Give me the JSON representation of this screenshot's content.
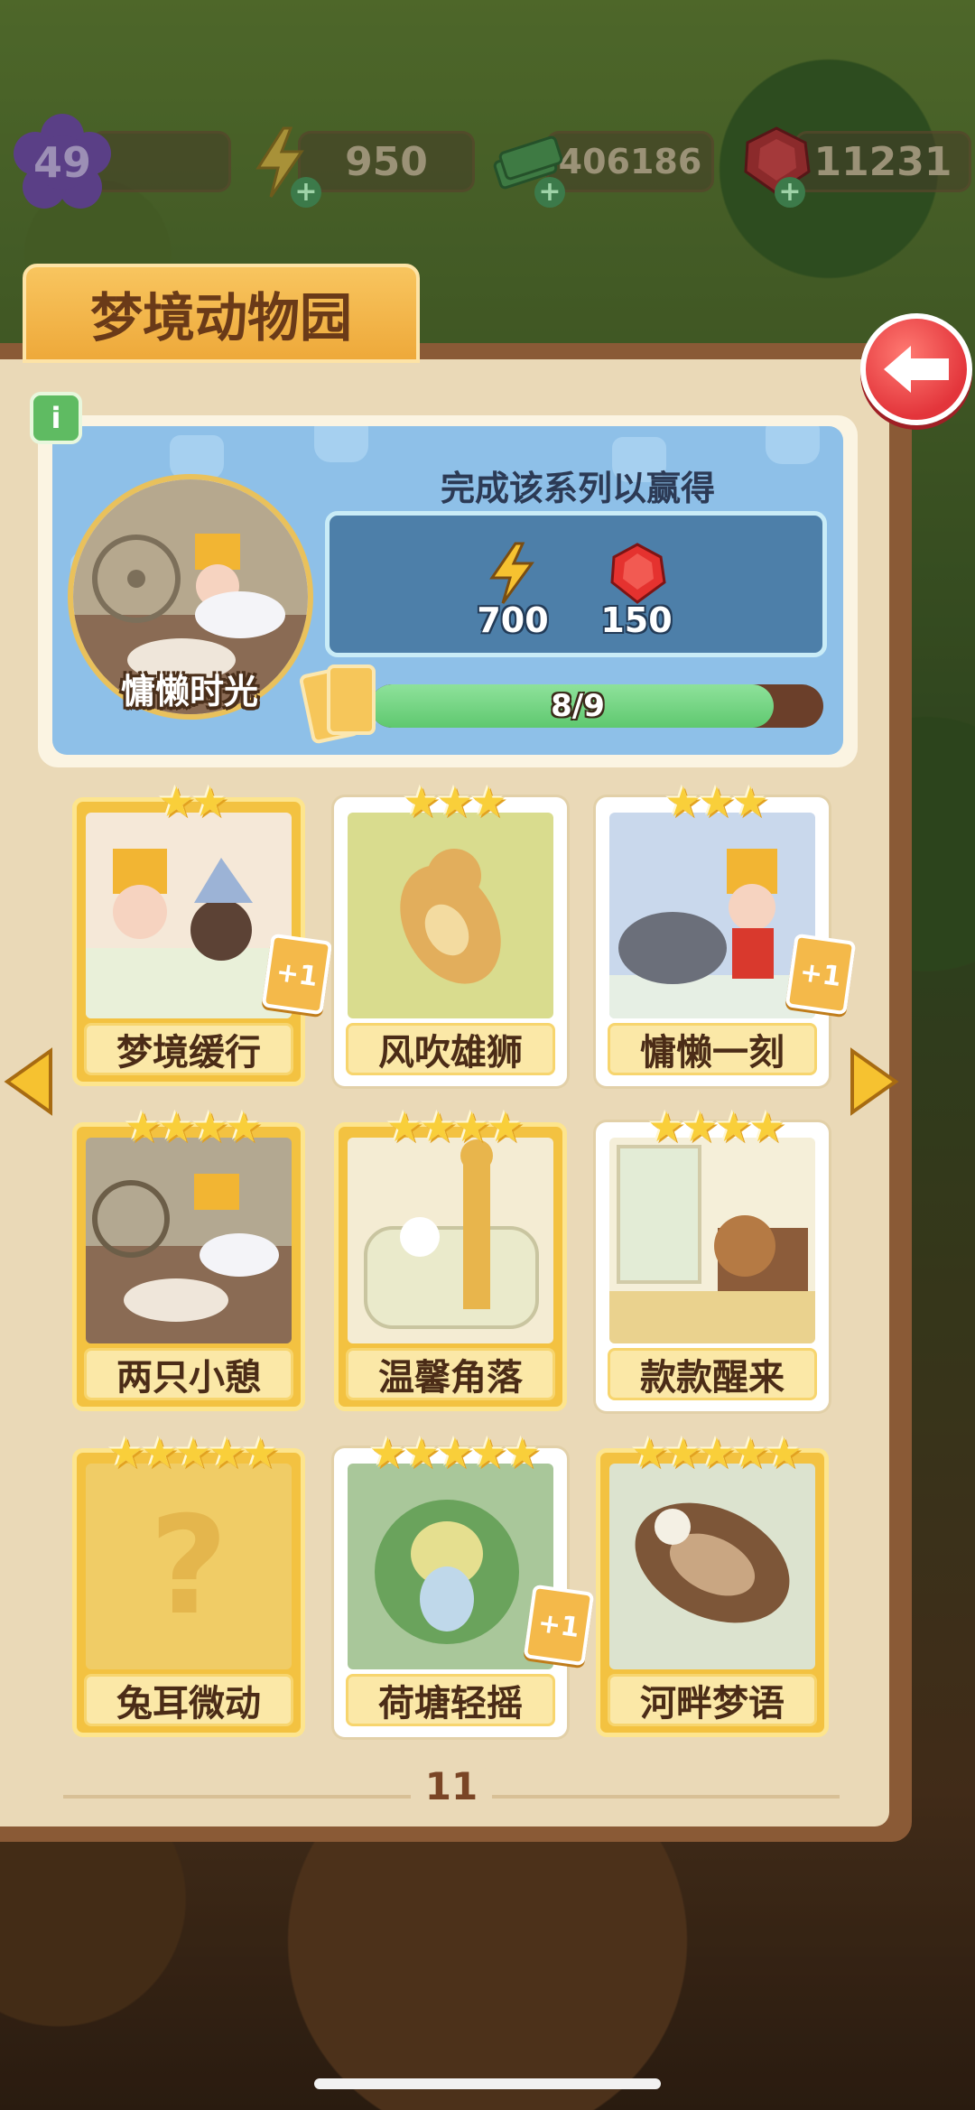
{
  "resources": {
    "level": "49",
    "energy": "950",
    "cash": "406186",
    "gems": "11231"
  },
  "panel": {
    "title": "梦境动物园",
    "info_label": "i"
  },
  "collection": {
    "name": "慵懒时光",
    "reward_title": "完成该系列以赢得",
    "rewards": [
      {
        "icon": "lightning-icon",
        "amount": "700"
      },
      {
        "icon": "ruby-icon",
        "amount": "150"
      }
    ],
    "progress_text": "8/9",
    "progress_fraction": 0.89
  },
  "cards": [
    {
      "label": "梦境缓行",
      "stars": 2,
      "style": "gold",
      "plus": "+1"
    },
    {
      "label": "风吹雄狮",
      "stars": 3,
      "style": "white",
      "plus": ""
    },
    {
      "label": "慵懒一刻",
      "stars": 3,
      "style": "white",
      "plus": "+1"
    },
    {
      "label": "两只小憩",
      "stars": 4,
      "style": "gold",
      "plus": ""
    },
    {
      "label": "温馨角落",
      "stars": 4,
      "style": "gold",
      "plus": ""
    },
    {
      "label": "款款醒来",
      "stars": 4,
      "style": "white",
      "plus": ""
    },
    {
      "label": "兔耳微动",
      "stars": 5,
      "style": "gold",
      "plus": "",
      "locked_glyph": "?"
    },
    {
      "label": "荷塘轻摇",
      "stars": 5,
      "style": "white",
      "plus": "+1"
    },
    {
      "label": "河畔梦语",
      "stars": 5,
      "style": "gold",
      "plus": ""
    }
  ],
  "pagination": {
    "page": "11"
  },
  "colors": {
    "accent_gold": "#f3c241",
    "progress_green": "#6fd07c",
    "back_red": "#e3353b",
    "panel_brown": "#8a5a36"
  }
}
